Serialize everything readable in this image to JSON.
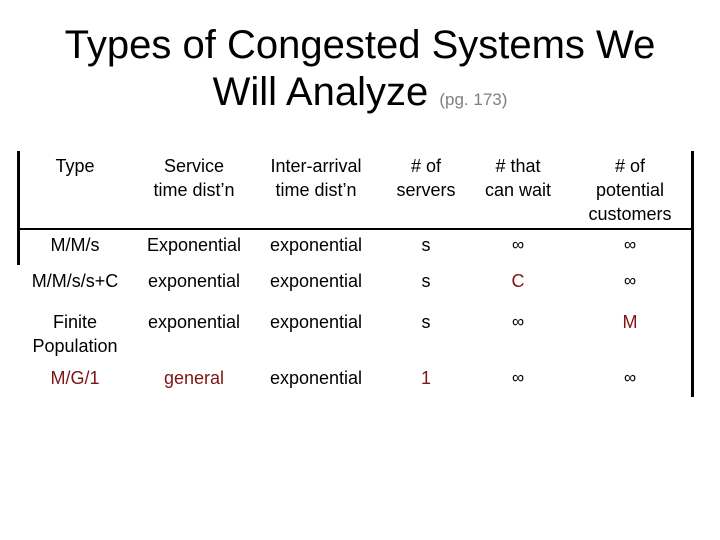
{
  "slide": {
    "title_line1": "Types of Congested Systems We",
    "title_line2": "Will Analyze",
    "title_subnote": "(pg. 173)"
  },
  "table": {
    "headers": [
      {
        "line1": "Type",
        "line2": "",
        "line3": ""
      },
      {
        "line1": "Service",
        "line2": "time dist’n",
        "line3": ""
      },
      {
        "line1": "Inter-arrival",
        "line2": "time dist’n",
        "line3": ""
      },
      {
        "line1": "# of",
        "line2": "servers",
        "line3": ""
      },
      {
        "line1": "# that",
        "line2": "can wait",
        "line3": ""
      },
      {
        "line1": "# of",
        "line2": "potential",
        "line3": "customers"
      }
    ],
    "rows": [
      {
        "type": "M/M/s",
        "type_line2": "",
        "service": "Exponential",
        "interarrival": "exponential",
        "servers": "s",
        "can_wait": "∞",
        "potential": "∞"
      },
      {
        "type": "M/M/s/s+C",
        "type_line2": "",
        "service": "exponential",
        "interarrival": "exponential",
        "servers": "s",
        "can_wait": "C",
        "potential": "∞"
      },
      {
        "type": "Finite",
        "type_line2": "Population",
        "service": "exponential",
        "interarrival": "exponential",
        "servers": "s",
        "can_wait": "∞",
        "potential": "M"
      },
      {
        "type": "M/G/1",
        "type_line2": "",
        "service": "general",
        "interarrival": "exponential",
        "servers": "1",
        "can_wait": "∞",
        "potential": "∞"
      }
    ]
  },
  "colors": {
    "text": "#000000",
    "highlight": "#7f1416",
    "subnote": "#7f7f7f",
    "rules": "#000000"
  }
}
